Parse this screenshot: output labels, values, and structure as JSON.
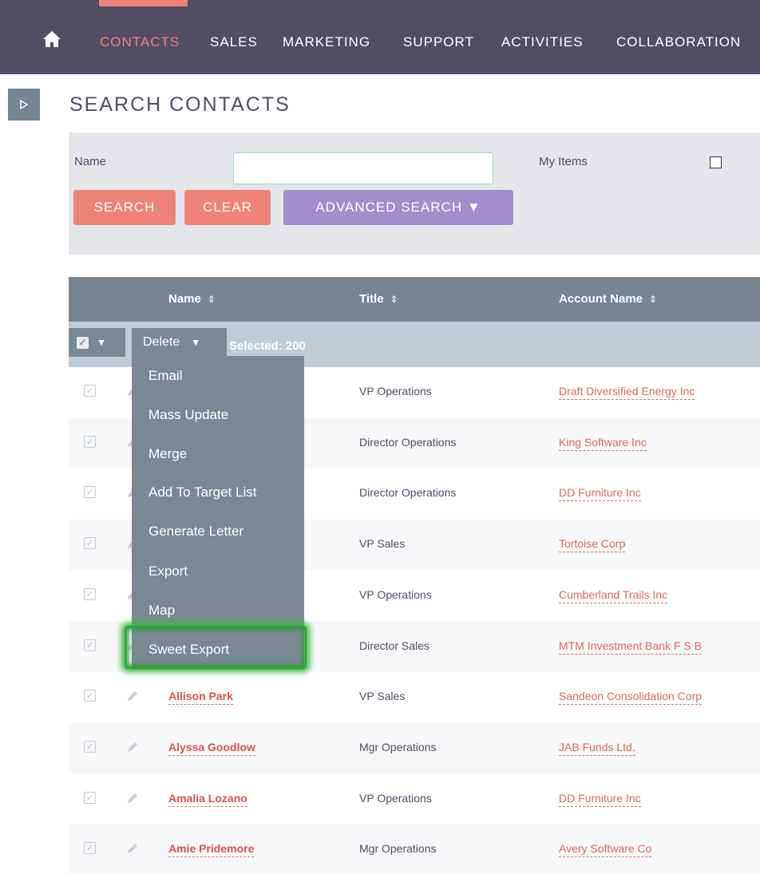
{
  "nav": {
    "items": [
      {
        "label": "CONTACTS",
        "active": true
      },
      {
        "label": "SALES"
      },
      {
        "label": "MARKETING"
      },
      {
        "label": "SUPPORT"
      },
      {
        "label": "ACTIVITIES"
      },
      {
        "label": "COLLABORATION"
      }
    ]
  },
  "page": {
    "title": "SEARCH CONTACTS"
  },
  "search": {
    "name_label": "Name",
    "name_value": "",
    "my_items_label": "My Items",
    "search_button": "SEARCH",
    "clear_button": "CLEAR",
    "advanced_button": "ADVANCED SEARCH ▼"
  },
  "table": {
    "columns": [
      {
        "label": "Name",
        "sort": "⇕"
      },
      {
        "label": "Title",
        "sort": "⇕"
      },
      {
        "label": "Account Name",
        "sort": "⇕"
      }
    ],
    "bulk": {
      "delete_label": "Delete",
      "selected_label": "Selected: 200"
    },
    "rows": [
      {
        "name": "",
        "title": "VP Operations",
        "account": "Draft Diversified Energy Inc"
      },
      {
        "name": "",
        "title": "Director Operations",
        "account": "King Software Inc"
      },
      {
        "name": "",
        "title": "Director Operations",
        "account": "DD Furniture Inc"
      },
      {
        "name": "",
        "title": "VP Sales",
        "account": "Tortoise Corp"
      },
      {
        "name": "",
        "title": "VP Operations",
        "account": "Cumberland Trails Inc"
      },
      {
        "name": "",
        "title": "Director Sales",
        "account": "MTM Investment Bank F S B"
      },
      {
        "name": "Allison Park",
        "title": "VP Sales",
        "account": "Sandeon Consolidation Corp"
      },
      {
        "name": "Alyssa Goodlow",
        "title": "Mgr Operations",
        "account": "JAB Funds Ltd."
      },
      {
        "name": "Amalia Lozano",
        "title": "VP Operations",
        "account": "DD Furniture Inc"
      },
      {
        "name": "Amie Pridemore",
        "title": "Mgr Operations",
        "account": "Avery Software Co"
      }
    ]
  },
  "bulk_menu": {
    "items": [
      "Email",
      "Mass Update",
      "Merge",
      "Add To Target List",
      "Generate Letter",
      "Export",
      "Map",
      "Sweet Export"
    ],
    "highlighted": "Sweet Export"
  },
  "colors": {
    "nav_bg": "#534d64",
    "accent": "#f08377",
    "advanced": "#a08fcc",
    "header_bg": "#778591",
    "highlight": "#3db844"
  }
}
